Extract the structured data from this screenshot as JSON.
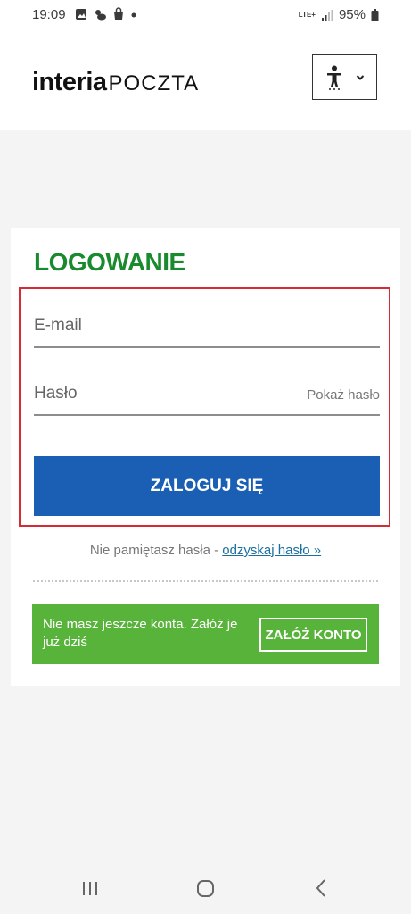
{
  "status_bar": {
    "time": "19:09",
    "network": "LTE+",
    "battery": "95%",
    "icons": [
      "gallery-icon",
      "weather-icon",
      "shopping-bag-icon",
      "dot-icon",
      "signal-icon",
      "battery-icon"
    ]
  },
  "header": {
    "logo_brand": "interia",
    "logo_product": "POCZTA",
    "accessibility_icon": "accessibility-icon",
    "accessibility_chevron": "chevron-down-icon"
  },
  "login": {
    "title": "LOGOWANIE",
    "email_placeholder": "E-mail",
    "password_placeholder": "Hasło",
    "show_password": "Pokaż hasło",
    "submit_label": "ZALOGUJ SIĘ",
    "forgot_text": "Nie pamiętasz hasła - ",
    "forgot_link": "odzyskaj hasło »",
    "colors": {
      "title": "#1a8a2e",
      "button": "#1b5fb4",
      "highlight": "#d52b35"
    }
  },
  "register": {
    "message": "Nie masz jeszcze konta. Załóż je już dziś",
    "button_label": "ZAŁÓŻ KONTO",
    "color": "#58b33a"
  },
  "nav_bar": {
    "icons": [
      "recent-apps-icon",
      "home-icon",
      "back-icon"
    ]
  }
}
